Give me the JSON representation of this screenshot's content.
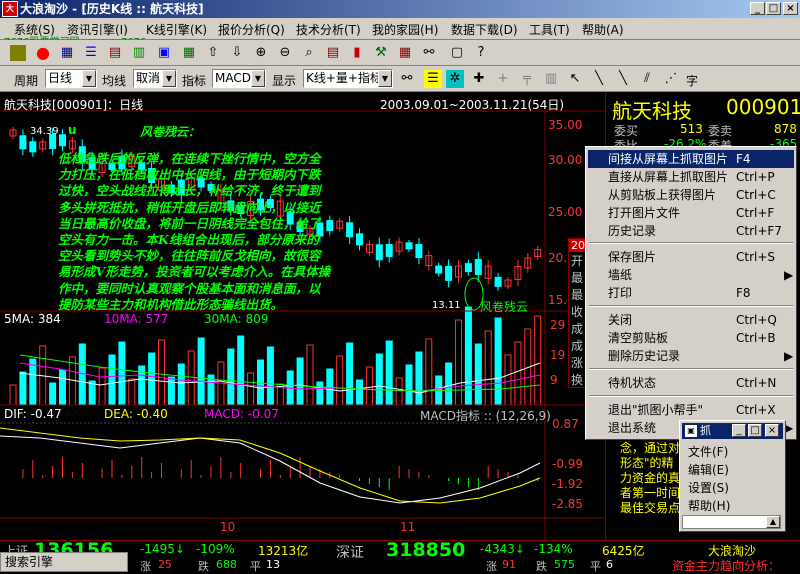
{
  "window": {
    "title": "大浪淘沙 - [历史K线 :: 航天科技]",
    "icon_text": "大浪"
  },
  "menu": [
    "系统(S)",
    "资讯引擎(I)",
    "K线引擎(K)",
    "报价分析(Q)",
    "技术分析(T)",
    "我的家园(H)",
    "数据下载(D)",
    "工具(T)",
    "帮助(A)"
  ],
  "watermark": "7676股票学习网  www.cx7676",
  "toolbar2": {
    "period_label": "周期",
    "period_value": "日线",
    "ma_label": "均线",
    "ma_value": "取消",
    "indicator_label": "指标",
    "indicator_value": "MACD",
    "display_label": "显示",
    "display_value": "K线+量+指标",
    "text_tool": "字"
  },
  "chart": {
    "stock_header": "航天科技[000901]：日线",
    "date_range": "2003.09.01~2003.11.21(54日)",
    "price_labels": [
      "35.00",
      "30.00",
      "25.00",
      "20.00",
      "15.00"
    ],
    "high_marker": "34.39",
    "low_marker": "13.11",
    "mark_u": "u",
    "annotation_title": "风卷残云：",
    "annotation_lines": [
      "低档急跌后的反弹，在连续下挫行情中，空方全",
      "力打压，在低档收出中长阴线，由于短期内下跌",
      "过快，空头战线拉得太长，补给不济，终于遭到",
      "多头拼死抵抗，稍低开盘后即转盘向上，以接近",
      "当日最高价收盘，将前一日阴线完全包住，给了",
      "空头有力一击。本K线组合出现后，部分原来的",
      "空头看到势头不妙，往往阵前反戈相向，故很容",
      "易形成V形走势，投资者可以考虑介入。在具体操",
      "作中，要同时认真观察个股基本面和消息面，以",
      "提防某些主力和机构借此形态骗线出货。"
    ],
    "pattern_label": "风卷残云",
    "vol_ma": {
      "ma5": "5MA: 384",
      "ma10": "10MA: 577",
      "ma30": "30MA: 809"
    },
    "vol_labels": [
      "29",
      "19",
      "9"
    ],
    "macd": {
      "dif": "DIF: -0.47",
      "dea": "DEA: -0.40",
      "macd": "MACD: -0.07",
      "title": "MACD指标 :: (12,26,9)"
    },
    "macd_labels": [
      "0.87",
      "-0.99",
      "-1.92",
      "-2.85"
    ],
    "x_labels": [
      "10",
      "11"
    ]
  },
  "right_panel": {
    "name": "航天科技",
    "code": "000901",
    "row1_label": "委买",
    "row1_val": "513",
    "row1_label2": "委卖",
    "row1_val2": "878",
    "row2_label": "委比",
    "row2_val": "-26.2%",
    "row2_label2": "委差",
    "row2_val2": "-365",
    "side_labels": [
      "20",
      "开",
      "最",
      "最",
      "收",
      "成",
      "成",
      "涨",
      "换"
    ],
    "text_lines": [
      "念，通过对",
      "形态\"的精",
      "力资金的真",
      "者第一时间",
      "最佳交易点"
    ]
  },
  "context_menu": {
    "items": [
      {
        "label": "间接从屏幕上抓取图片",
        "key": "F4",
        "selected": true
      },
      {
        "label": "直接从屏幕上抓取图片",
        "key": "Ctrl+P"
      },
      {
        "label": "从剪贴板上获得图片",
        "key": "Ctrl+C"
      },
      {
        "label": "打开图片文件",
        "key": "Ctrl+F"
      },
      {
        "label": "历史记录",
        "key": "Ctrl+F7"
      },
      {
        "label": "保存图片",
        "key": "Ctrl+S"
      },
      {
        "label": "墙纸",
        "key": "▶"
      },
      {
        "label": "打印",
        "key": "F8"
      },
      {
        "label": "关闭",
        "key": "Ctrl+Q"
      },
      {
        "label": "清空剪贴板",
        "key": "Ctrl+B"
      },
      {
        "label": "删除历史记录",
        "key": "▶"
      },
      {
        "label": "待机状态",
        "key": "Ctrl+N"
      },
      {
        "label": "退出\"抓图小帮手\"",
        "key": "Ctrl+X"
      },
      {
        "label": "退出系统",
        "key": "▶"
      }
    ]
  },
  "helper_window": {
    "title": "抓",
    "items": [
      "文件(F)",
      "编辑(E)",
      "设置(S)",
      "帮助(H)"
    ]
  },
  "status": {
    "sh_label": "上证",
    "sh_value": "136156",
    "sh_change": "-1495↓",
    "sh_pct": "-109%",
    "sh_amount": "13213亿",
    "sh_up": "涨",
    "sh_up_n": "25",
    "sh_down": "跌",
    "sh_down_n": "688",
    "sh_flat": "平",
    "sh_flat_n": "13",
    "sz_label": "深证",
    "sz_value": "318850",
    "sz_change": "-4343↓",
    "sz_pct": "-134%",
    "sz_amount": "6425亿",
    "sz_up": "涨",
    "sz_up_n": "91",
    "sz_down": "跌",
    "sz_down_n": "575",
    "sz_flat": "平",
    "sz_flat_n": "6",
    "app_name": "大浪淘沙",
    "ticker": "资金主力趋向分析："
  },
  "search_bar": "搜索引擎"
}
